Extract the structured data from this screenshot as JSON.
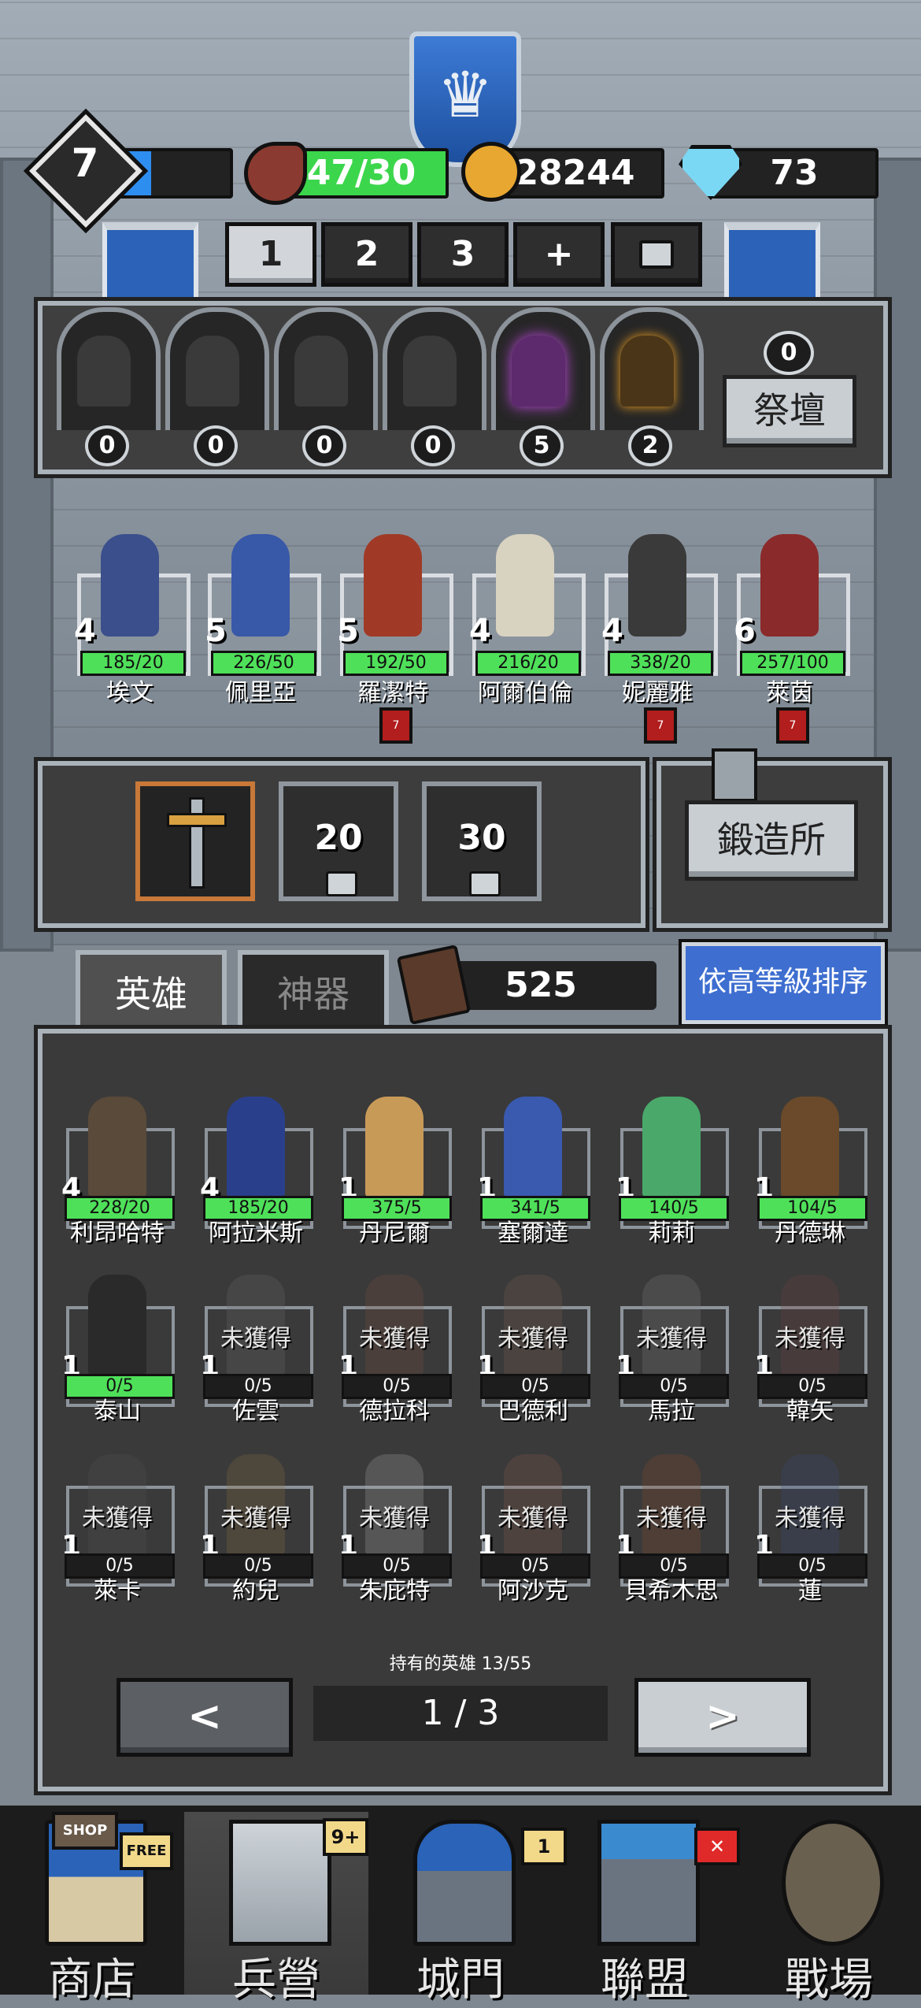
{
  "header": {
    "level": "7",
    "meat": "47/30",
    "gold": "28244",
    "gems": "73"
  },
  "team_tabs": [
    "1",
    "2",
    "3",
    "+"
  ],
  "altar": {
    "counts": [
      "0",
      "0",
      "0",
      "0",
      "5",
      "2"
    ],
    "altar_count": "0",
    "altar_label": "祭壇"
  },
  "team": [
    {
      "level": "4",
      "hp": "185/20",
      "name": "埃文",
      "color": "#3a4f8c"
    },
    {
      "level": "5",
      "hp": "226/50",
      "name": "佩里亞",
      "color": "#3858a8"
    },
    {
      "level": "5",
      "hp": "192/50",
      "name": "羅潔特",
      "color": "#a03a26"
    },
    {
      "level": "4",
      "hp": "216/20",
      "name": "阿爾伯倫",
      "color": "#d8d2c0"
    },
    {
      "level": "4",
      "hp": "338/20",
      "name": "妮麗雅",
      "color": "#3a3a3a"
    },
    {
      "level": "6",
      "hp": "257/100",
      "name": "萊茵",
      "color": "#8a2a2a"
    }
  ],
  "hearts": [
    "7",
    "7",
    "7"
  ],
  "weapon_slots": [
    "20",
    "30"
  ],
  "forge_label": "鍛造所",
  "tabs": {
    "heroes": "英雄",
    "artifacts": "神器"
  },
  "book_count": "525",
  "sort_label": "依高等級排序",
  "roster": [
    {
      "level": "4",
      "bar": "228/20",
      "name": "利昂哈特",
      "owned": true,
      "color": "#5a4a3a"
    },
    {
      "level": "4",
      "bar": "185/20",
      "name": "阿拉米斯",
      "owned": true,
      "color": "#2a3f8c"
    },
    {
      "level": "1",
      "bar": "375/5",
      "name": "丹尼爾",
      "owned": true,
      "color": "#c89a58"
    },
    {
      "level": "1",
      "bar": "341/5",
      "name": "塞爾達",
      "owned": true,
      "color": "#3a5ab0"
    },
    {
      "level": "1",
      "bar": "140/5",
      "name": "莉莉",
      "owned": true,
      "color": "#4aa86a"
    },
    {
      "level": "1",
      "bar": "104/5",
      "name": "丹德琳",
      "owned": true,
      "color": "#6a4a2a"
    },
    {
      "level": "1",
      "bar": "0/5",
      "name": "泰山",
      "owned": true,
      "color": "#2a2a2a"
    },
    {
      "level": "1",
      "bar": "0/5",
      "name": "佐雲",
      "owned": false,
      "color": "#6a6a6a"
    },
    {
      "level": "1",
      "bar": "0/5",
      "name": "德拉科",
      "owned": false,
      "color": "#7a5040"
    },
    {
      "level": "1",
      "bar": "0/5",
      "name": "巴德利",
      "owned": false,
      "color": "#7a6050"
    },
    {
      "level": "1",
      "bar": "0/5",
      "name": "馬拉",
      "owned": false,
      "color": "#808080"
    },
    {
      "level": "1",
      "bar": "0/5",
      "name": "韓矢",
      "owned": false,
      "color": "#704040"
    },
    {
      "level": "1",
      "bar": "0/5",
      "name": "萊卡",
      "owned": false,
      "color": "#555555"
    },
    {
      "level": "1",
      "bar": "0/5",
      "name": "約兒",
      "owned": false,
      "color": "#8a7040"
    },
    {
      "level": "1",
      "bar": "0/5",
      "name": "朱庇特",
      "owned": false,
      "color": "#aaaaaa"
    },
    {
      "level": "1",
      "bar": "0/5",
      "name": "阿沙克",
      "owned": false,
      "color": "#8a5a4a"
    },
    {
      "level": "1",
      "bar": "0/5",
      "name": "貝希木思",
      "owned": false,
      "color": "#8a4a2a"
    },
    {
      "level": "1",
      "bar": "0/5",
      "name": "蓮",
      "owned": false,
      "color": "#3a4a7a"
    }
  ],
  "unobtained_label": "未獲得",
  "owned_text": "持有的英雄 13/55",
  "pagination": {
    "prev": "<",
    "indicator": "1 / 3",
    "next": ">"
  },
  "nav": [
    {
      "label": "商店",
      "badge": "FREE",
      "sign": "SHOP"
    },
    {
      "label": "兵營",
      "badge": "9+"
    },
    {
      "label": "城門",
      "badge": "1"
    },
    {
      "label": "聯盟",
      "badge": "✕"
    },
    {
      "label": "戰場",
      "badge": ""
    }
  ]
}
